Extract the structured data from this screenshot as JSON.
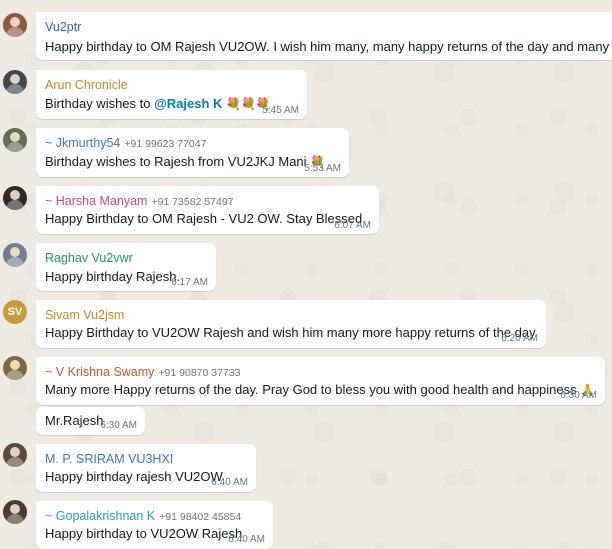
{
  "colors": {
    "chat_background": "#efeae2",
    "bubble_background": "#ffffff",
    "timestamp": "#667781",
    "mention": "#027eb5"
  },
  "messages": [
    {
      "sender": "Vu2ptr",
      "sender_color": "#3b5bd1",
      "phone": "",
      "text": "Happy birthday to OM Rajesh VU2OW. I wish him many, many happy returns of the day and many happy y",
      "time": "",
      "avatar": {
        "type": "photo",
        "color": "#8a5a44",
        "initials": ""
      }
    },
    {
      "sender": "Arun Chronicle",
      "sender_color": "#c98a1a",
      "phone": "",
      "text_before": "Birthday wishes to ",
      "mention": "@Rajesh K",
      "emoji": "💐💐💐",
      "time": "5:45 AM",
      "avatar": {
        "type": "photo",
        "color": "#3e4753",
        "initials": ""
      }
    },
    {
      "sender": "~ Jkmurthy54",
      "sender_color": "#3b75c9",
      "phone": "+91 99623 77047",
      "text": "Birthday wishes to Rajesh from VU2JKJ Mani",
      "emoji": "💐",
      "time": "5:53 AM",
      "avatar": {
        "type": "photo",
        "color": "#5f6e55",
        "initials": ""
      }
    },
    {
      "sender": "~ Harsha Manyam",
      "sender_color": "#c0478f",
      "phone": "+91 73582 57497",
      "text": "Happy Birthday to OM Rajesh - VU2 OW. Stay Blessed",
      "time": "6:07 AM",
      "avatar": {
        "type": "photo",
        "color": "#2f2a25",
        "initials": ""
      }
    },
    {
      "sender": "Raghav Vu2vwr",
      "sender_color": "#1f9a5a",
      "phone": "",
      "text": "Happy birthday Rajesh.",
      "time": "6:17 AM",
      "avatar": {
        "type": "photo",
        "color": "#6f7e92",
        "initials": ""
      }
    },
    {
      "sender": "Sivam Vu2jsm",
      "sender_color": "#c98a1a",
      "phone": "",
      "text": "Happy Birthday to VU2OW Rajesh and wish him many more happy returns of the day",
      "time": "6:20 AM",
      "avatar": {
        "type": "initials",
        "color": "#c99a3a",
        "initials": "SV"
      }
    },
    {
      "sender": "~ V Krishna Swamy",
      "sender_color": "#c8562b",
      "phone": "+91 90870 37733",
      "text": "Many more Happy returns of the day. Pray God to bless you with good health and happiness",
      "emoji": "🙏",
      "time": "6:30 AM",
      "avatar": {
        "type": "photo",
        "color": "#7d6a3a",
        "initials": ""
      }
    },
    {
      "sender": "",
      "sender_color": "",
      "phone": "",
      "text": "Mr.Rajesh",
      "time": "6:30 AM",
      "avatar": null
    },
    {
      "sender": "M. P. SRIRAM VU3HXI",
      "sender_color": "#3b75c9",
      "phone": "",
      "text": "Happy birthday rajesh VU2OW",
      "time": "6:40 AM",
      "avatar": {
        "type": "photo",
        "color": "#5c4a3e",
        "initials": ""
      }
    },
    {
      "sender": "~ Gopalakrishnan K",
      "sender_color": "#2a9bc4",
      "phone": "+91 98402 45854",
      "text": "Happy birthday to VU2OW Rajesh",
      "time": "6:40 AM",
      "avatar": {
        "type": "photo",
        "color": "#4a3b2e",
        "initials": ""
      }
    }
  ]
}
